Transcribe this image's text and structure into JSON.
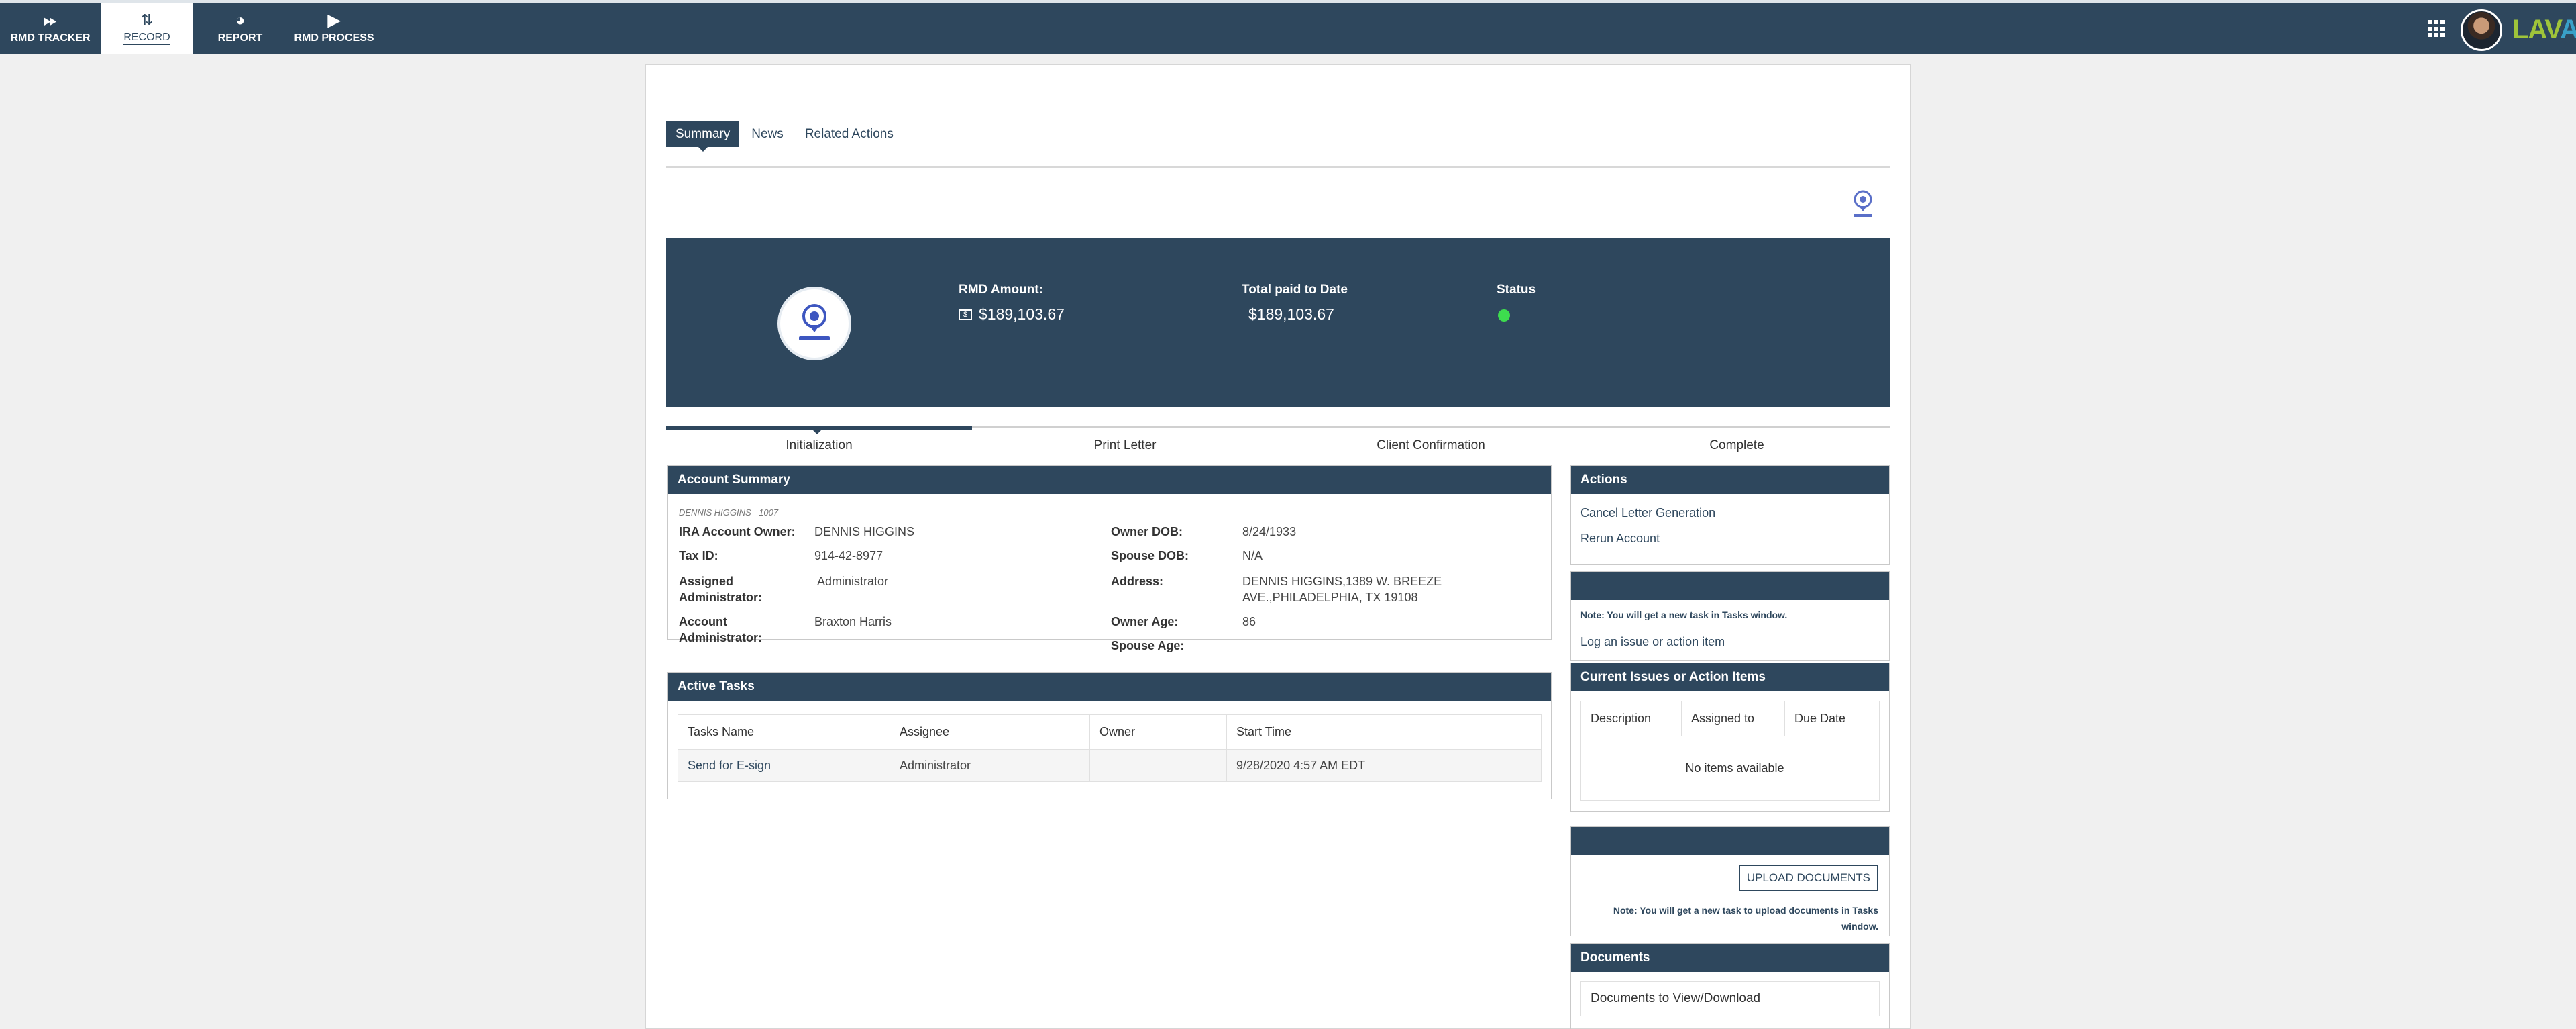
{
  "nav": {
    "items": [
      {
        "label": "RMD TRACKER",
        "icon": "fast-forward-icon"
      },
      {
        "label": "RECORD",
        "icon": "sort-icon"
      },
      {
        "label": "REPORT",
        "icon": "pie-chart-icon"
      },
      {
        "label": "RMD PROCESS",
        "icon": "play-icon"
      }
    ],
    "brand": {
      "part1": "LAV",
      "part2": "A"
    }
  },
  "tabs": [
    "Summary",
    "News",
    "Related Actions"
  ],
  "banner": {
    "rmd_amount_label": "RMD Amount:",
    "rmd_amount": "$189,103.67",
    "total_paid_label": "Total paid to Date",
    "total_paid": "$189,103.67",
    "status_label": "Status",
    "status_color": "#3ddc4e"
  },
  "steps": [
    "Initialization",
    "Print Letter",
    "Client Confirmation",
    "Complete"
  ],
  "account_summary": {
    "title": "Account Summary",
    "subtitle": "DENNIS HIGGINS - 1007",
    "left": [
      {
        "label": "IRA Account Owner:",
        "value": "DENNIS HIGGINS"
      },
      {
        "label": "Tax ID:",
        "value": "914-42-8977"
      },
      {
        "label": "Assigned Administrator:",
        "value": "Administrator"
      },
      {
        "label": "Account Administrator:",
        "value": "Braxton Harris"
      }
    ],
    "right": [
      {
        "label": "Owner DOB:",
        "value": "8/24/1933"
      },
      {
        "label": "Spouse DOB:",
        "value": "N/A"
      },
      {
        "label": "Address:",
        "value": "DENNIS HIGGINS,1389 W. BREEZE AVE.,PHILADELPHIA, TX 19108"
      },
      {
        "label": "Owner Age:",
        "value": "86"
      },
      {
        "label": "Spouse Age:",
        "value": ""
      }
    ]
  },
  "active_tasks": {
    "title": "Active Tasks",
    "columns": [
      "Tasks Name",
      "Assignee",
      "Owner",
      "Start Time"
    ],
    "rows": [
      [
        "Send for E-sign",
        "Administrator",
        "",
        "9/28/2020 4:57 AM EDT"
      ]
    ]
  },
  "actions": {
    "title": "Actions",
    "links": [
      "Cancel Letter Generation",
      "Rerun Account"
    ]
  },
  "issue_panel": {
    "note": "Note: You will get a new task in Tasks window.",
    "link": "Log an issue or action item"
  },
  "current_issues": {
    "title": "Current Issues or Action Items",
    "columns": [
      "Description",
      "Assigned to",
      "Due Date"
    ],
    "empty": "No items available"
  },
  "upload": {
    "button": "UPLOAD DOCUMENTS",
    "note": "Note: You will get a new task to upload documents in Tasks window."
  },
  "documents": {
    "title": "Documents",
    "item": "Documents to View/Download"
  }
}
